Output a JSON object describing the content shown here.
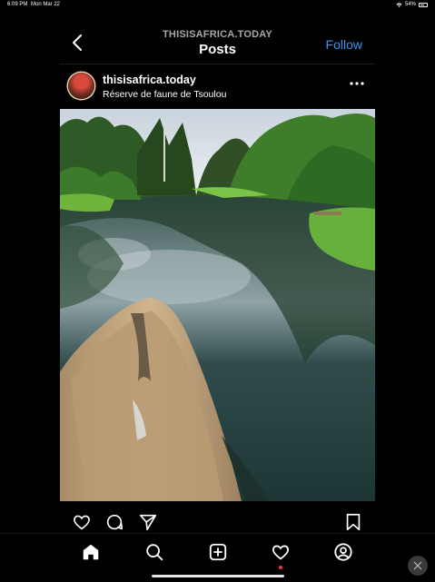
{
  "status_bar": {
    "time": "6:09 PM",
    "date": "Mon Mar 22",
    "battery": "54%"
  },
  "header": {
    "subtitle": "THISISAFRICA.TODAY",
    "title": "Posts",
    "follow_label": "Follow"
  },
  "post": {
    "username": "thisisafrica.today",
    "location": "Réserve de faune de Tsoulou"
  },
  "icons": {
    "back": "chevron-left-icon",
    "more": "more-horizontal-icon",
    "like": "heart-icon",
    "comment": "comment-icon",
    "share": "send-icon",
    "save": "bookmark-icon",
    "nav": [
      "home-icon",
      "search-icon",
      "plus-square-icon",
      "heart-icon",
      "profile-icon"
    ]
  },
  "colors": {
    "accent": "#3797f0",
    "notification": "#ff3040",
    "background": "#000000"
  }
}
